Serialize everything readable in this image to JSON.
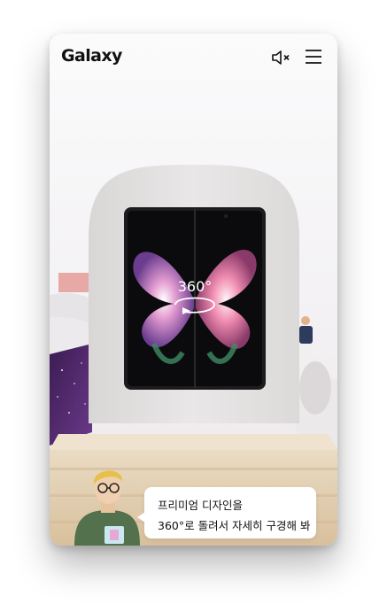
{
  "header": {
    "brand": "Galaxy",
    "mute_icon": "speaker-muted-icon",
    "menu_icon": "hamburger-menu-icon"
  },
  "viewer": {
    "rotate_label": "360°",
    "rotate_icon": "rotate-360-icon"
  },
  "guide": {
    "line1": "프리미엄 디자인을",
    "line2": "360°로 돌려서 자세히 구경해 봐"
  },
  "colors": {
    "arch": "#e4e1e1",
    "pedestal": "#e6d2b4",
    "phone_frame": "#1c1c1e",
    "text": "#111111"
  }
}
